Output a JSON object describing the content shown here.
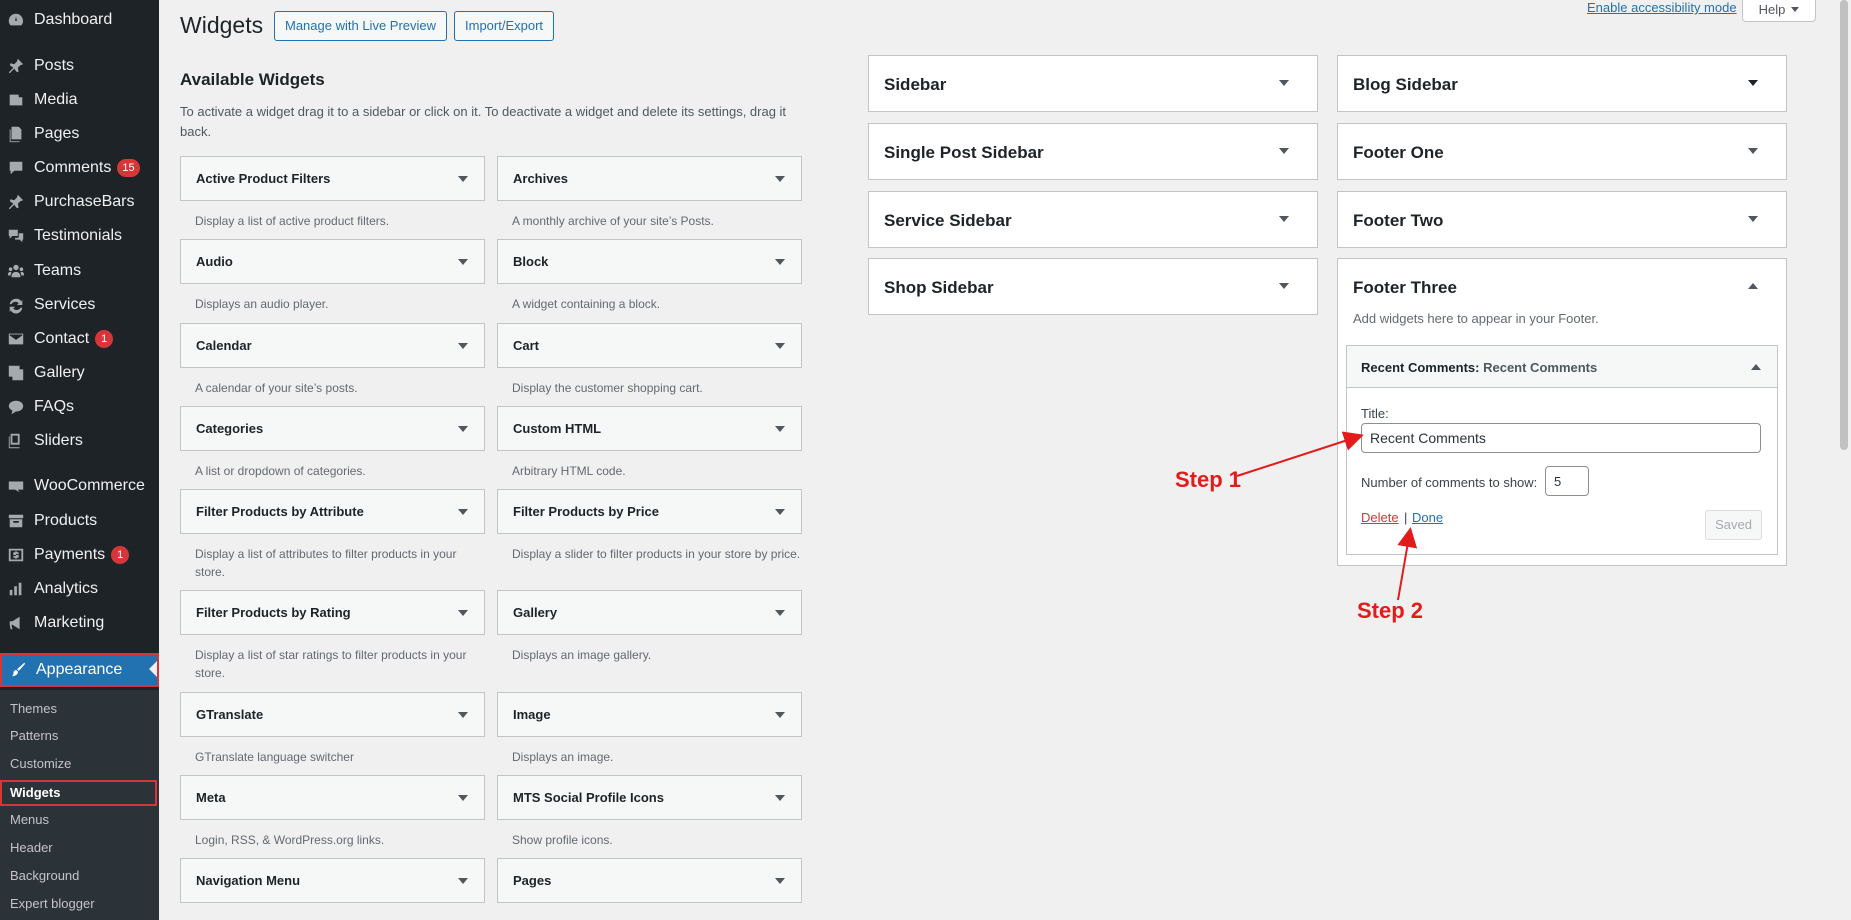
{
  "menu": {
    "dashboard": "Dashboard",
    "posts": "Posts",
    "media": "Media",
    "pages": "Pages",
    "comments": "Comments",
    "comments_badge": "15",
    "purchasebars": "PurchaseBars",
    "testimonials": "Testimonials",
    "teams": "Teams",
    "services": "Services",
    "contact": "Contact",
    "contact_badge": "1",
    "gallery": "Gallery",
    "faqs": "FAQs",
    "sliders": "Sliders",
    "woocommerce": "WooCommerce",
    "products": "Products",
    "payments": "Payments",
    "payments_badge": "1",
    "analytics": "Analytics",
    "marketing": "Marketing",
    "appearance": "Appearance",
    "sub": {
      "themes": "Themes",
      "patterns": "Patterns",
      "customize": "Customize",
      "widgets": "Widgets",
      "menus": "Menus",
      "header": "Header",
      "background": "Background",
      "expert": "Expert blogger"
    }
  },
  "header": {
    "title": "Widgets",
    "live_preview": "Manage with Live Preview",
    "import_export": "Import/Export",
    "accessibility": "Enable accessibility mode",
    "help": "Help"
  },
  "available": {
    "title": "Available Widgets",
    "desc": "To activate a widget drag it to a sidebar or click on it. To deactivate a widget and delete its settings, drag it back.",
    "widgets": [
      {
        "title": "Active Product Filters",
        "desc": "Display a list of active product filters."
      },
      {
        "title": "Archives",
        "desc": "A monthly archive of your site’s Posts."
      },
      {
        "title": "Audio",
        "desc": "Displays an audio player."
      },
      {
        "title": "Block",
        "desc": "A widget containing a block."
      },
      {
        "title": "Calendar",
        "desc": "A calendar of your site’s posts."
      },
      {
        "title": "Cart",
        "desc": "Display the customer shopping cart."
      },
      {
        "title": "Categories",
        "desc": "A list or dropdown of categories."
      },
      {
        "title": "Custom HTML",
        "desc": "Arbitrary HTML code."
      },
      {
        "title": "Filter Products by Attribute",
        "desc": "Display a list of attributes to filter products in your store."
      },
      {
        "title": "Filter Products by Price",
        "desc": "Display a slider to filter products in your store by price."
      },
      {
        "title": "Filter Products by Rating",
        "desc": "Display a list of star ratings to filter products in your store."
      },
      {
        "title": "Gallery",
        "desc": "Displays an image gallery."
      },
      {
        "title": "GTranslate",
        "desc": "GTranslate language switcher"
      },
      {
        "title": "Image",
        "desc": "Displays an image."
      },
      {
        "title": "Meta",
        "desc": "Login, RSS, & WordPress.org links."
      },
      {
        "title": "MTS Social Profile Icons",
        "desc": "Show profile icons."
      },
      {
        "title": "Navigation Menu",
        "desc": ""
      },
      {
        "title": "Pages",
        "desc": ""
      }
    ]
  },
  "sidebars": {
    "sidebar": "Sidebar",
    "single_post": "Single Post Sidebar",
    "service": "Service Sidebar",
    "shop": "Shop Sidebar",
    "blog": "Blog Sidebar",
    "footer_one": "Footer One",
    "footer_two": "Footer Two",
    "footer_three": "Footer Three",
    "footer_three_desc": "Add widgets here to appear in your Footer."
  },
  "recent_comments": {
    "head_title": "Recent Comments",
    "head_sub": "Recent Comments",
    "title_label": "Title:",
    "title_value": "Recent Comments",
    "num_label": "Number of comments to show:",
    "num_value": "5",
    "delete": "Delete",
    "separator": "|",
    "done": "Done",
    "saved": "Saved"
  },
  "annotations": {
    "step1": "Step 1",
    "step2": "Step 2",
    "color": "#e21b1b"
  }
}
